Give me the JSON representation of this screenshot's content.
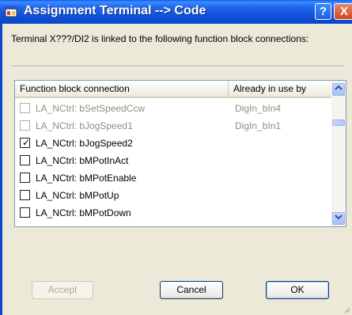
{
  "window": {
    "title": "Assignment Terminal --> Code",
    "help_label": "?",
    "close_label": "X"
  },
  "description": "Terminal X???/DI2 is linked to the following function block connections:",
  "list": {
    "columns": [
      "Function block connection",
      "Already in use by"
    ],
    "rows": [
      {
        "connection": "LA_NCtrl: bSetSpeedCcw",
        "in_use_by": "DigIn_bIn4",
        "checked": false,
        "disabled": true
      },
      {
        "connection": "LA_NCtrl: bJogSpeed1",
        "in_use_by": "DigIn_bIn1",
        "checked": false,
        "disabled": true
      },
      {
        "connection": "LA_NCtrl: bJogSpeed2",
        "in_use_by": "",
        "checked": true,
        "disabled": false
      },
      {
        "connection": "LA_NCtrl: bMPotInAct",
        "in_use_by": "",
        "checked": false,
        "disabled": false
      },
      {
        "connection": "LA_NCtrl: bMPotEnable",
        "in_use_by": "",
        "checked": false,
        "disabled": false
      },
      {
        "connection": "LA_NCtrl: bMPotUp",
        "in_use_by": "",
        "checked": false,
        "disabled": false
      },
      {
        "connection": "LA_NCtrl: bMPotDown",
        "in_use_by": "",
        "checked": false,
        "disabled": false
      }
    ],
    "check_glyph": "✓"
  },
  "buttons": {
    "accept": "Accept",
    "cancel": "Cancel",
    "ok": "OK"
  },
  "colors": {
    "titlebar": "#0A47C8",
    "disabled_text": "#8E8D84",
    "dialog_bg": "#ECE9D8"
  },
  "icons": {
    "app": "app-window-icon",
    "scroll_up": "chevron-up-icon",
    "scroll_down": "chevron-down-icon"
  }
}
